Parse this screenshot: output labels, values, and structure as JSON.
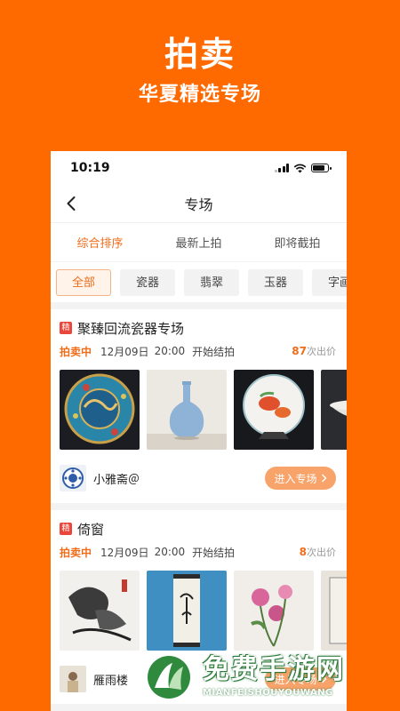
{
  "promo": {
    "title": "拍卖",
    "subtitle": "华夏精选专场"
  },
  "status_bar": {
    "time": "10:19"
  },
  "nav": {
    "title": "专场",
    "back_icon": "chevron-left-icon"
  },
  "sort_tabs": [
    {
      "label": "综合排序",
      "active": true
    },
    {
      "label": "最新上拍",
      "active": false
    },
    {
      "label": "即将截拍",
      "active": false
    }
  ],
  "categories": [
    {
      "label": "全部",
      "active": true
    },
    {
      "label": "瓷器",
      "active": false
    },
    {
      "label": "翡翠",
      "active": false
    },
    {
      "label": "玉器",
      "active": false
    },
    {
      "label": "字画",
      "active": false
    }
  ],
  "auctions": [
    {
      "badge": "精",
      "title": "聚臻回流瓷器专场",
      "status": "拍卖中",
      "date": "12月09日",
      "time": "20:00",
      "action": "开始结拍",
      "bid_count": "87",
      "bid_suffix": "次出价",
      "seller": "小雅斋＠",
      "button": "进入专场"
    },
    {
      "badge": "精",
      "title": "倚窗",
      "status": "拍卖中",
      "date": "12月09日",
      "time": "20:00",
      "action": "开始结拍",
      "bid_count": "8",
      "bid_suffix": "次出价",
      "seller": "雁雨楼",
      "button": "进入专场"
    }
  ],
  "watermark": {
    "text": "免费手游网",
    "sub": "MIANFEISHOUYOUWANG"
  },
  "colors": {
    "brand_orange": "#ff6a00",
    "accent": "#ef6d1a",
    "badge_red": "#e9473b",
    "button": "#f7a36a"
  }
}
